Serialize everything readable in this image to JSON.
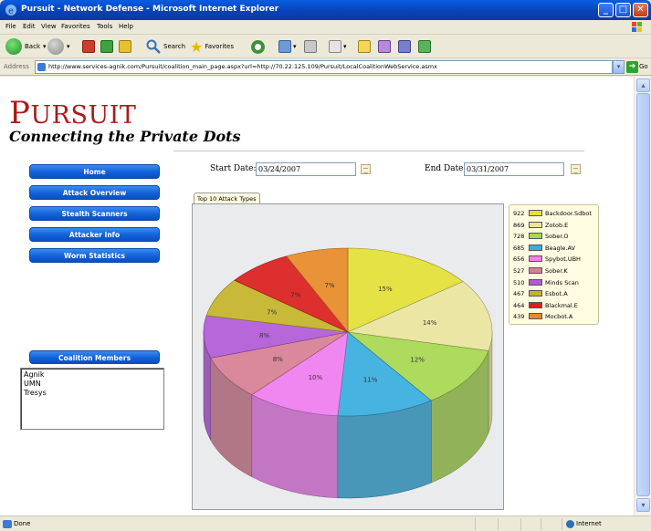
{
  "window": {
    "title": "Pursuit - Network Defense - Microsoft Internet Explorer",
    "min": "_",
    "max": "□",
    "close": "✕"
  },
  "menu": [
    "File",
    "Edit",
    "View",
    "Favorites",
    "Tools",
    "Help"
  ],
  "toolbar": {
    "back": "Back",
    "search": "Search",
    "favorites": "Favorites"
  },
  "address": {
    "label": "Address",
    "url": "http://www.services-agnik.com/Pursuit/coalition_main_page.aspx?url=http://70.22.125.109/Pursuit/LocalCoalitionWebService.asmx",
    "go": "Go"
  },
  "status": {
    "text": "Done",
    "zone": "Internet"
  },
  "brand": {
    "logo_first": "P",
    "logo_rest": "URSUIT",
    "tagline": "Connecting the Private Dots"
  },
  "nav": [
    "Home",
    "Attack Overview",
    "Stealth Scanners",
    "Attacker Info",
    "Worm Statistics"
  ],
  "dates": {
    "start_label": "Start Date:",
    "start_value": "03/24/2007",
    "end_label": "End Date:",
    "end_value": "03/31/2007"
  },
  "chart_tab": "Top 10 Attack Types",
  "coalition": {
    "title": "Coalition Members",
    "members": [
      "Agnik",
      "UMN",
      "Tresys"
    ]
  },
  "chart_data": {
    "type": "pie",
    "title": "",
    "categories": [
      "Backdoor.Sdbot",
      "Zotob.E",
      "Sober.O",
      "Beagle.AV",
      "Spybot.UBH",
      "Sober.K",
      "Minds Scan",
      "Esbot.A",
      "Blackmal.E",
      "Mocbot.A"
    ],
    "values": [
      922,
      869,
      728,
      685,
      656,
      527,
      510,
      467,
      464,
      439
    ],
    "labels": [
      "15%",
      "14%",
      "12%",
      "11%",
      "10%",
      "8%",
      "8%",
      "7%",
      "7%",
      "7%"
    ],
    "colors": [
      "#e3e135",
      "#ebe59e",
      "#a8d850",
      "#38aee0",
      "#f07ef0",
      "#d87f95",
      "#b25bd8",
      "#c4b428",
      "#dc1e1e",
      "#e88a28"
    ],
    "legend": "right"
  }
}
